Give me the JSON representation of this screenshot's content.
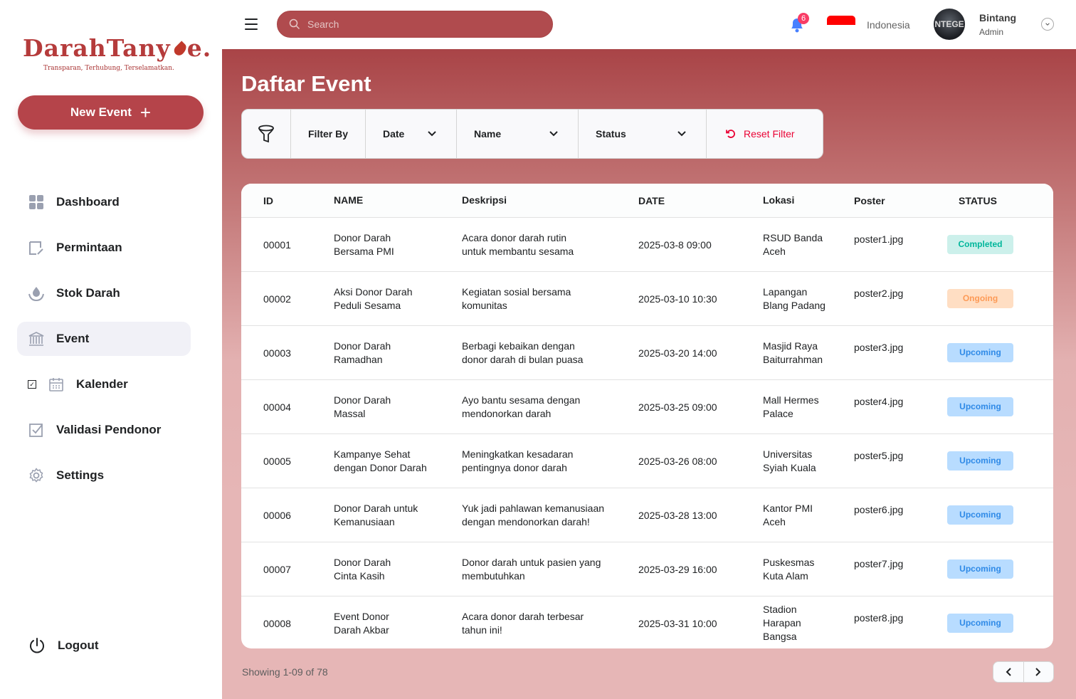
{
  "sidebar": {
    "logo_text_a": "DarahTany",
    "logo_text_b": "e.",
    "tagline": "Transparan, Terhubung, Terselamatkan.",
    "new_event_label": "New Event",
    "items": [
      {
        "label": "Dashboard",
        "icon": "dashboard-icon"
      },
      {
        "label": "Permintaan",
        "icon": "request-icon"
      },
      {
        "label": "Stok Darah",
        "icon": "blood-stock-icon"
      },
      {
        "label": "Event",
        "icon": "building-icon"
      },
      {
        "label": "Kalender",
        "icon": "calendar-icon"
      },
      {
        "label": "Validasi Pendonor",
        "icon": "check-square-icon"
      },
      {
        "label": "Settings",
        "icon": "gear-icon"
      }
    ],
    "active_item": "Event",
    "logout_label": "Logout"
  },
  "topbar": {
    "search_placeholder": "Search",
    "notification_count": "6",
    "language": "Indonesia",
    "user_name": "Bintang",
    "user_role": "Admin",
    "avatar_text": "NTEGE"
  },
  "main": {
    "title": "Daftar Event",
    "filter": {
      "filter_by": "Filter By",
      "date": "Date",
      "name": "Name",
      "status": "Status",
      "reset": "Reset Filter"
    },
    "table": {
      "headers": [
        "ID",
        "NAME",
        "Deskripsi",
        "DATE",
        "Lokasi",
        "Poster",
        "STATUS"
      ],
      "rows": [
        {
          "id": "00001",
          "name": [
            "Donor Darah",
            "Bersama PMI"
          ],
          "desc": [
            "Acara donor darah rutin",
            "untuk membantu sesama"
          ],
          "date": "2025-03-8 09:00",
          "lokasi": [
            "RSUD Banda",
            "Aceh"
          ],
          "poster": "poster1.jpg",
          "status": "Completed"
        },
        {
          "id": "00002",
          "name": [
            "Aksi Donor Darah",
            "Peduli Sesama"
          ],
          "desc": [
            "Kegiatan sosial bersama",
            "komunitas"
          ],
          "date": "2025-03-10 10:30",
          "lokasi": [
            "Lapangan",
            "Blang Padang"
          ],
          "poster": "poster2.jpg",
          "status": "Ongoing"
        },
        {
          "id": "00003",
          "name": [
            "Donor Darah",
            "Ramadhan"
          ],
          "desc": [
            "Berbagi kebaikan dengan",
            "donor darah di bulan puasa"
          ],
          "date": "2025-03-20 14:00",
          "lokasi": [
            "Masjid Raya",
            "Baiturrahman"
          ],
          "poster": "poster3.jpg",
          "status": "Upcoming"
        },
        {
          "id": "00004",
          "name": [
            "Donor Darah",
            "Massal"
          ],
          "desc": [
            "Ayo bantu sesama dengan",
            "mendonorkan darah"
          ],
          "date": "2025-03-25 09:00",
          "lokasi": [
            "Mall Hermes",
            "Palace"
          ],
          "poster": "poster4.jpg",
          "status": "Upcoming"
        },
        {
          "id": "00005",
          "name": [
            "Kampanye Sehat",
            "dengan Donor Darah"
          ],
          "desc": [
            "Meningkatkan kesadaran",
            "pentingnya donor darah"
          ],
          "date": "2025-03-26 08:00",
          "lokasi": [
            "Universitas",
            "Syiah Kuala"
          ],
          "poster": "poster5.jpg",
          "status": "Upcoming"
        },
        {
          "id": "00006",
          "name": [
            "Donor Darah untuk",
            "Kemanusiaan"
          ],
          "desc": [
            "Yuk jadi pahlawan kemanusiaan",
            "dengan mendonorkan darah!"
          ],
          "date": "2025-03-28 13:00",
          "lokasi": [
            "Kantor PMI",
            "Aceh"
          ],
          "poster": "poster6.jpg",
          "status": "Upcoming"
        },
        {
          "id": "00007",
          "name": [
            "Donor Darah",
            "Cinta Kasih"
          ],
          "desc": [
            "Donor darah untuk pasien yang",
            "membutuhkan"
          ],
          "date": "2025-03-29 16:00",
          "lokasi": [
            "Puskesmas",
            "Kuta Alam"
          ],
          "poster": "poster7.jpg",
          "status": "Upcoming"
        },
        {
          "id": "00008",
          "name": [
            "Event Donor",
            "Darah Akbar"
          ],
          "desc": [
            "Acara donor darah terbesar",
            "tahun ini!"
          ],
          "date": "2025-03-31 10:00",
          "lokasi": [
            "Stadion",
            "Harapan",
            "Bangsa"
          ],
          "poster": "poster8.jpg",
          "status": "Upcoming"
        }
      ]
    },
    "showing": "Showing 1-09 of 78"
  },
  "colors": {
    "brand": "#b5444a",
    "completed": "#00b69b",
    "ongoing": "#fd9a56",
    "upcoming": "#2f8ae7",
    "reset": "#ea0234"
  }
}
